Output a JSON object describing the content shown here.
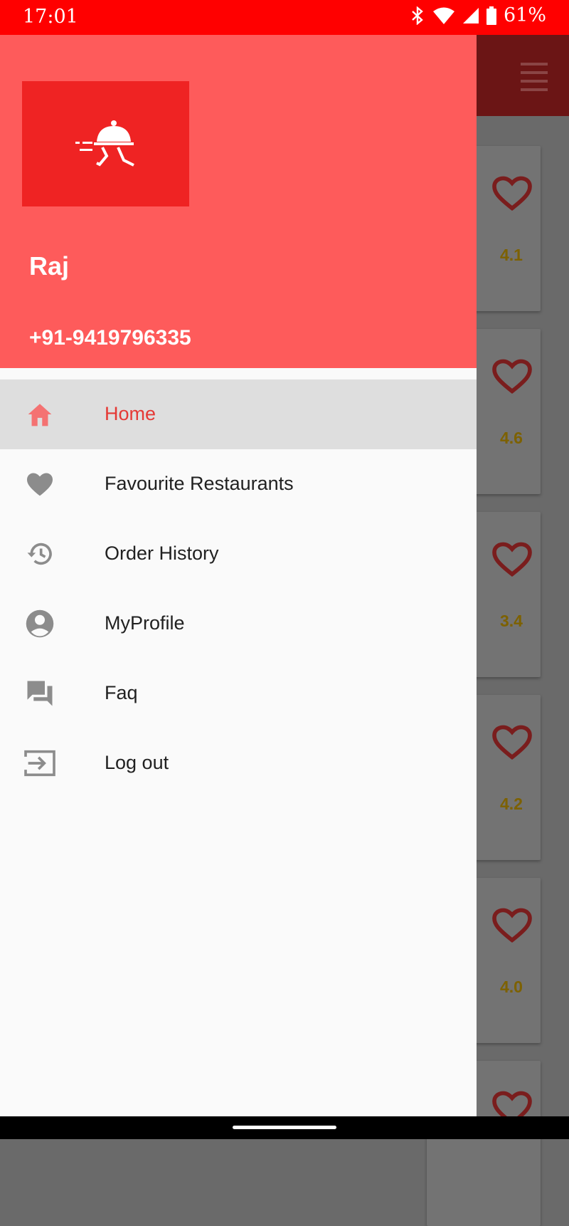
{
  "status_bar": {
    "time": "17:01",
    "battery": "61%",
    "icons": [
      "bluetooth-icon",
      "wifi-icon",
      "cell-signal-icon",
      "battery-icon"
    ]
  },
  "background_list": {
    "ratings": [
      "4.1",
      "4.6",
      "3.4",
      "4.2",
      "4.0"
    ]
  },
  "drawer": {
    "user_name": "Raj",
    "user_phone": "+91-9419796335",
    "items": [
      {
        "label": "Home",
        "icon": "home-icon",
        "active": true
      },
      {
        "label": "Favourite Restaurants",
        "icon": "heart-icon",
        "active": false
      },
      {
        "label": "Order History",
        "icon": "history-icon",
        "active": false
      },
      {
        "label": "MyProfile",
        "icon": "account-circle-icon",
        "active": false
      },
      {
        "label": "Faq",
        "icon": "forum-icon",
        "active": false
      },
      {
        "label": "Log out",
        "icon": "exit-icon",
        "active": false
      }
    ]
  },
  "colors": {
    "status_bar": "#ff0000",
    "drawer_header": "#fe5b5b",
    "logo_box": "#ef2323",
    "active_label": "#e53935",
    "active_bg": "#dedede"
  }
}
